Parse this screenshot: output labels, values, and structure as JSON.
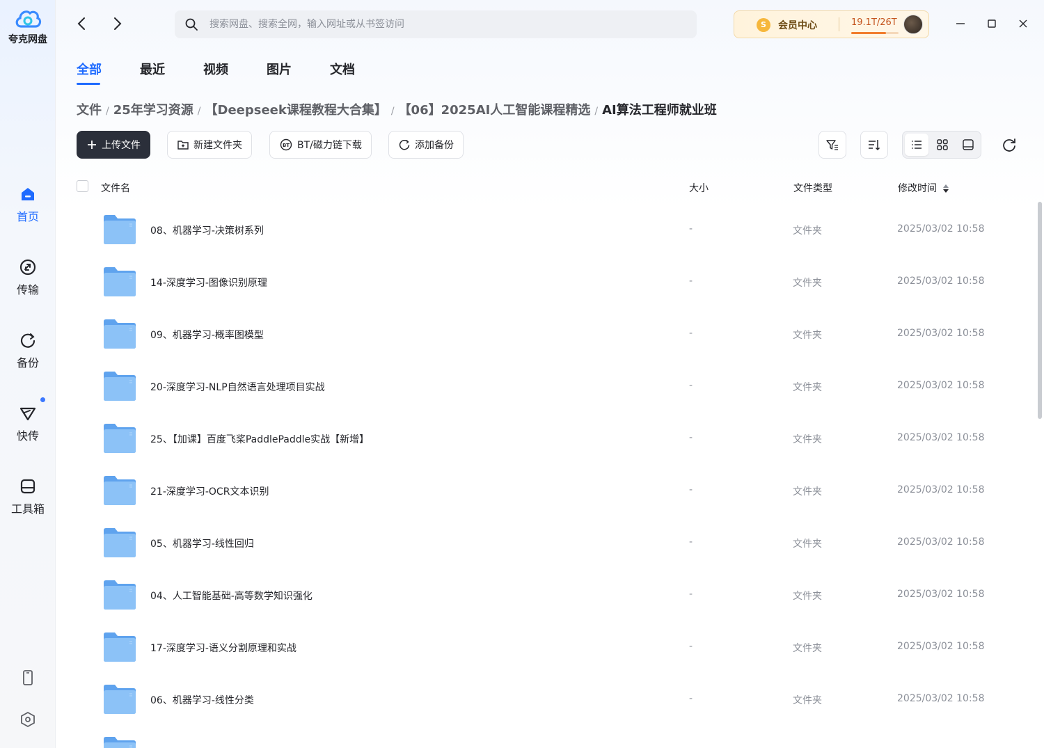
{
  "app": {
    "name": "夸克网盘"
  },
  "sidebar": {
    "items": [
      {
        "label": "首页",
        "icon": "home-icon",
        "active": true
      },
      {
        "label": "传输",
        "icon": "transfer-icon",
        "active": false
      },
      {
        "label": "备份",
        "icon": "backup-icon",
        "active": false
      },
      {
        "label": "快传",
        "icon": "send-icon",
        "active": false,
        "badge_dot": true
      },
      {
        "label": "工具箱",
        "icon": "toolbox-icon",
        "active": false
      }
    ],
    "bottom": [
      "phone-icon",
      "settings-icon"
    ]
  },
  "header": {
    "search_placeholder": "搜索网盘、搜索全网，输入网址或从书签访问",
    "vip_label": "会员中心",
    "storage_text": "19.1T/26T",
    "storage_used_fraction": 0.73
  },
  "tabs": [
    "全部",
    "最近",
    "视频",
    "图片",
    "文档"
  ],
  "breadcrumb": [
    "文件",
    "25年学习资源",
    "【Deepseek课程教程大合集】",
    "【06】2025AI人工智能课程精选",
    "AI算法工程师就业班"
  ],
  "toolbar": {
    "upload": "上传文件",
    "new_folder": "新建文件夹",
    "bt_download": "BT/磁力链下载",
    "add_backup": "添加备份"
  },
  "table": {
    "columns": {
      "name": "文件名",
      "size": "大小",
      "type": "文件类型",
      "modified": "修改时间"
    },
    "rows": [
      {
        "name": "08、机器学习-决策树系列",
        "size": "-",
        "type": "文件夹",
        "modified": "2025/03/02 10:58"
      },
      {
        "name": "14-深度学习-图像识别原理",
        "size": "-",
        "type": "文件夹",
        "modified": "2025/03/02 10:58"
      },
      {
        "name": "09、机器学习-概率图模型",
        "size": "-",
        "type": "文件夹",
        "modified": "2025/03/02 10:58"
      },
      {
        "name": "20-深度学习-NLP自然语言处理项目实战",
        "size": "-",
        "type": "文件夹",
        "modified": "2025/03/02 10:58"
      },
      {
        "name": "25、【加课】百度飞桨PaddlePaddle实战【新增】",
        "size": "-",
        "type": "文件夹",
        "modified": "2025/03/02 10:58"
      },
      {
        "name": "21-深度学习-OCR文本识别",
        "size": "-",
        "type": "文件夹",
        "modified": "2025/03/02 10:58"
      },
      {
        "name": "05、机器学习-线性回归",
        "size": "-",
        "type": "文件夹",
        "modified": "2025/03/02 10:58"
      },
      {
        "name": "04、人工智能基础-高等数学知识强化",
        "size": "-",
        "type": "文件夹",
        "modified": "2025/03/02 10:58"
      },
      {
        "name": "17-深度学习-语义分割原理和实战",
        "size": "-",
        "type": "文件夹",
        "modified": "2025/03/02 10:58"
      },
      {
        "name": "06、机器学习-线性分类",
        "size": "-",
        "type": "文件夹",
        "modified": "2025/03/02 10:58"
      },
      {
        "name": "",
        "size": "",
        "type": "",
        "modified": ""
      }
    ]
  },
  "colors": {
    "accent": "#1f6bff",
    "folder": "#7db6f5",
    "primary_button": "#2b2f3a"
  }
}
